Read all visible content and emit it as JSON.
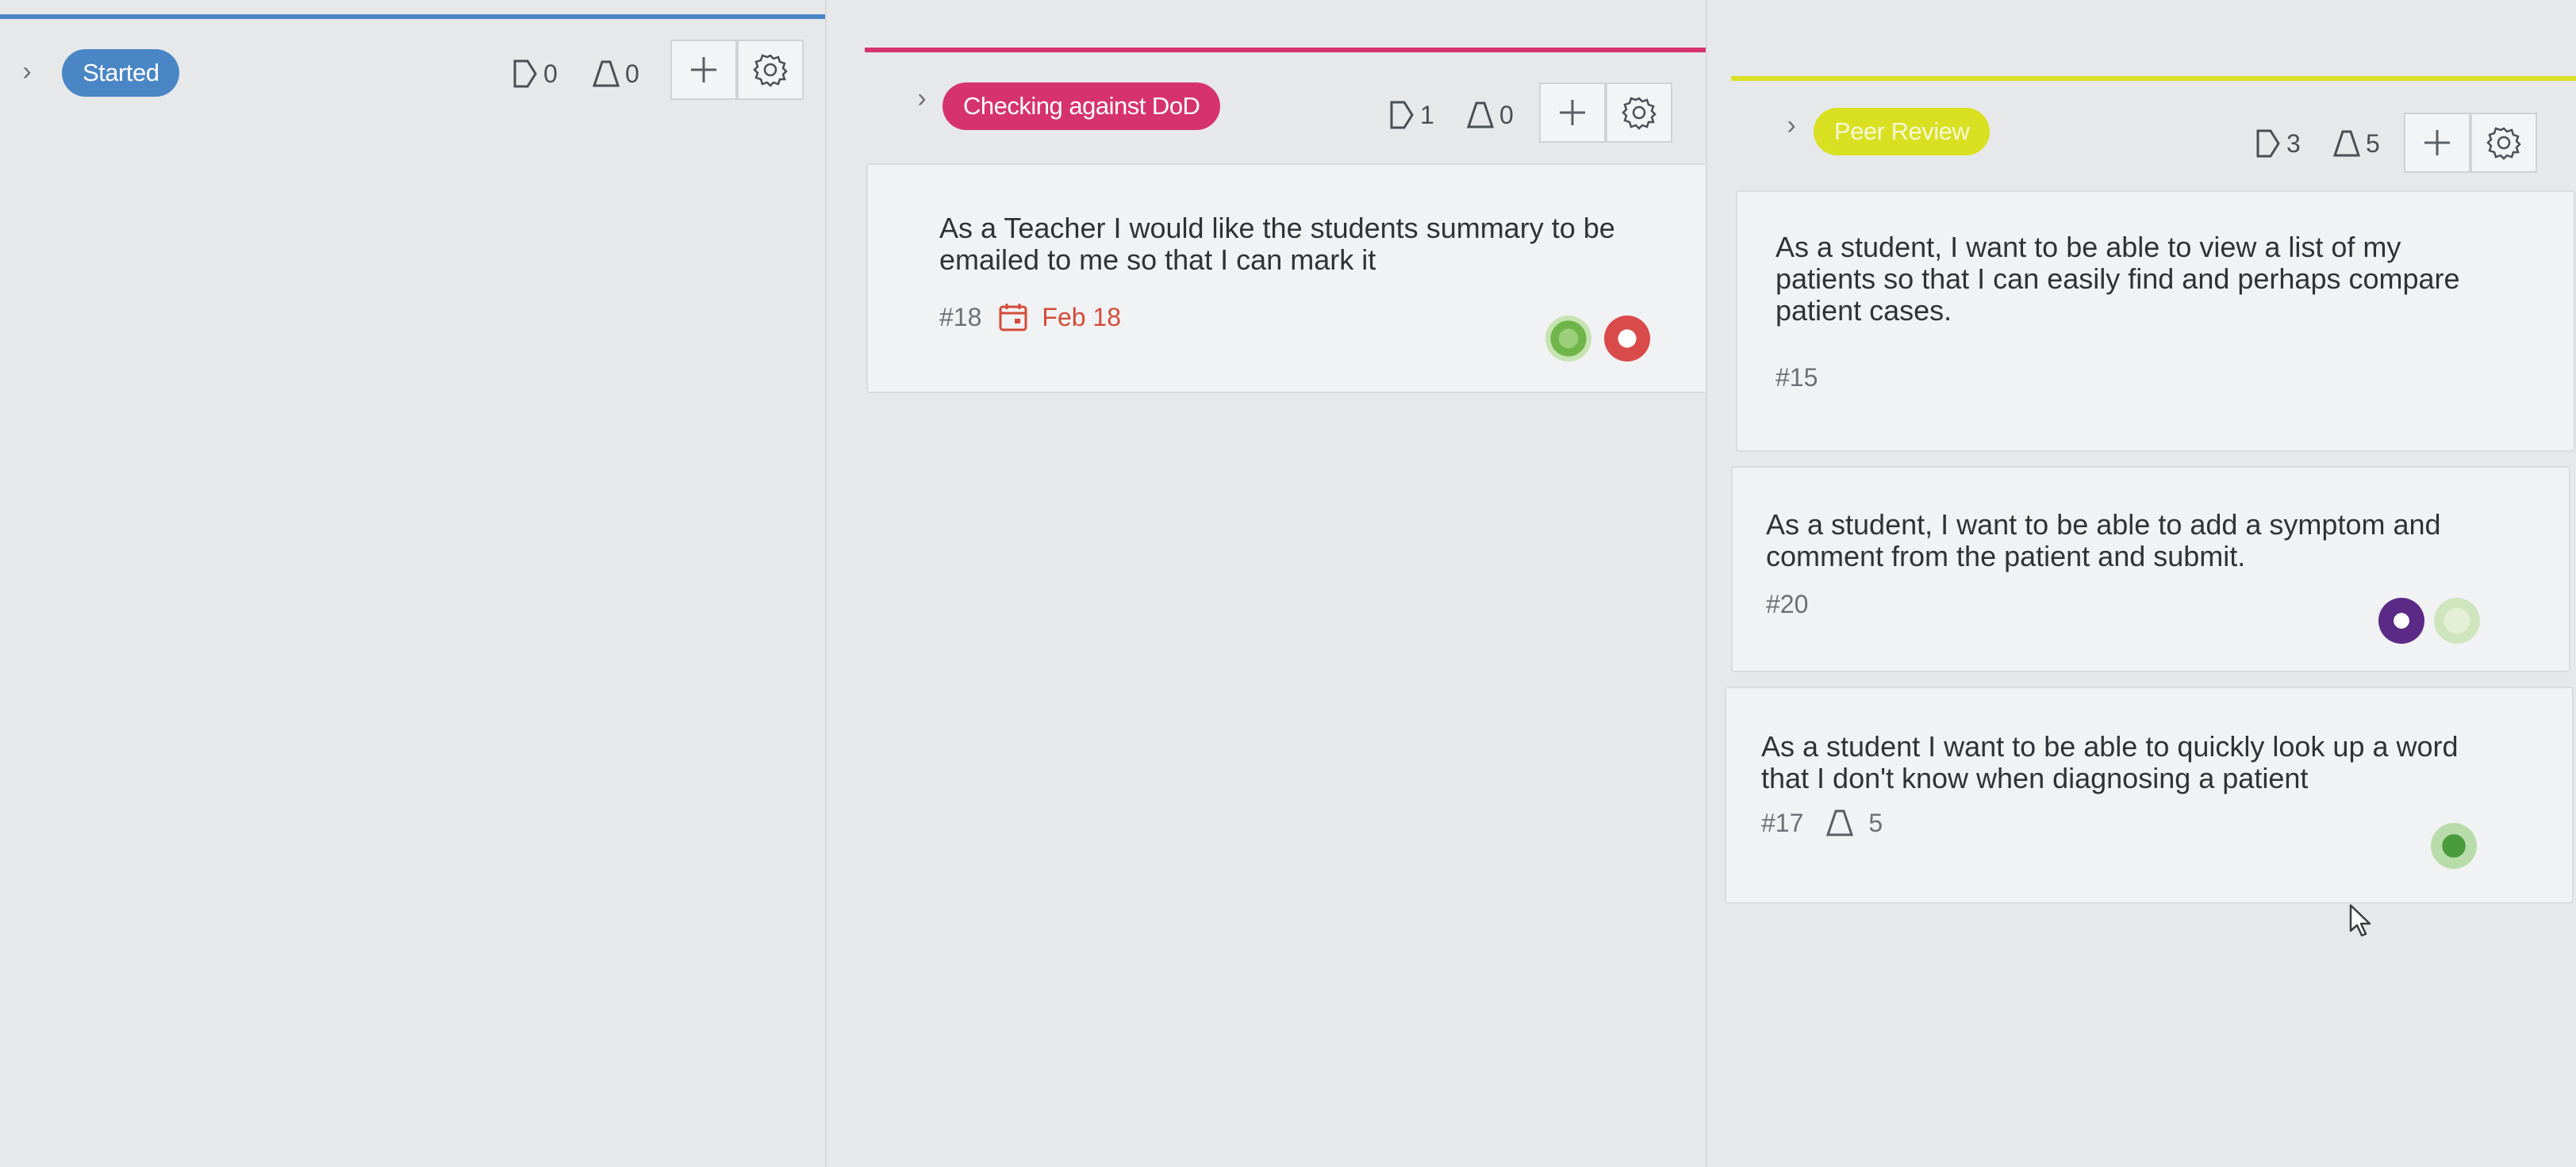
{
  "columns": [
    {
      "status": "Started",
      "accent": "#4a86c5",
      "stories_count": "0",
      "tasks_count": "0",
      "cards": []
    },
    {
      "status": "Checking against DoD",
      "accent": "#d6336c",
      "stories_count": "1",
      "tasks_count": "0",
      "cards": [
        {
          "title": "As a Teacher I would like the students summary to be emailed to me so that I can mark it",
          "ref": "#18",
          "due": "Feb 18",
          "avatars": [
            "green-pattern-avatar",
            "red-pattern-avatar"
          ]
        }
      ]
    },
    {
      "status": "Peer Review",
      "accent": "#d9e021",
      "stories_count": "3",
      "tasks_count": "5",
      "cards": [
        {
          "title": "As a student, I want to be able to view a list of my patients so that I can easily find and perhaps compare patient cases.",
          "ref": "#15"
        },
        {
          "title": "As a student, I want to be able to add a symptom and comment from the patient and submit.",
          "ref": "#20",
          "avatars": [
            "purple-pattern-avatar",
            "light-green-pattern-avatar"
          ]
        },
        {
          "title": "As a student I want to be able to quickly look up a word that I don't know when diagnosing a patient",
          "ref": "#17",
          "tasks": "5",
          "avatars": [
            "green-pattern-avatar"
          ]
        }
      ]
    }
  ],
  "icons": {
    "story": "story-icon",
    "task": "task-icon",
    "add": "plus-icon",
    "settings": "gear-icon",
    "expand": "chevron-right-icon",
    "due": "calendar-icon"
  }
}
